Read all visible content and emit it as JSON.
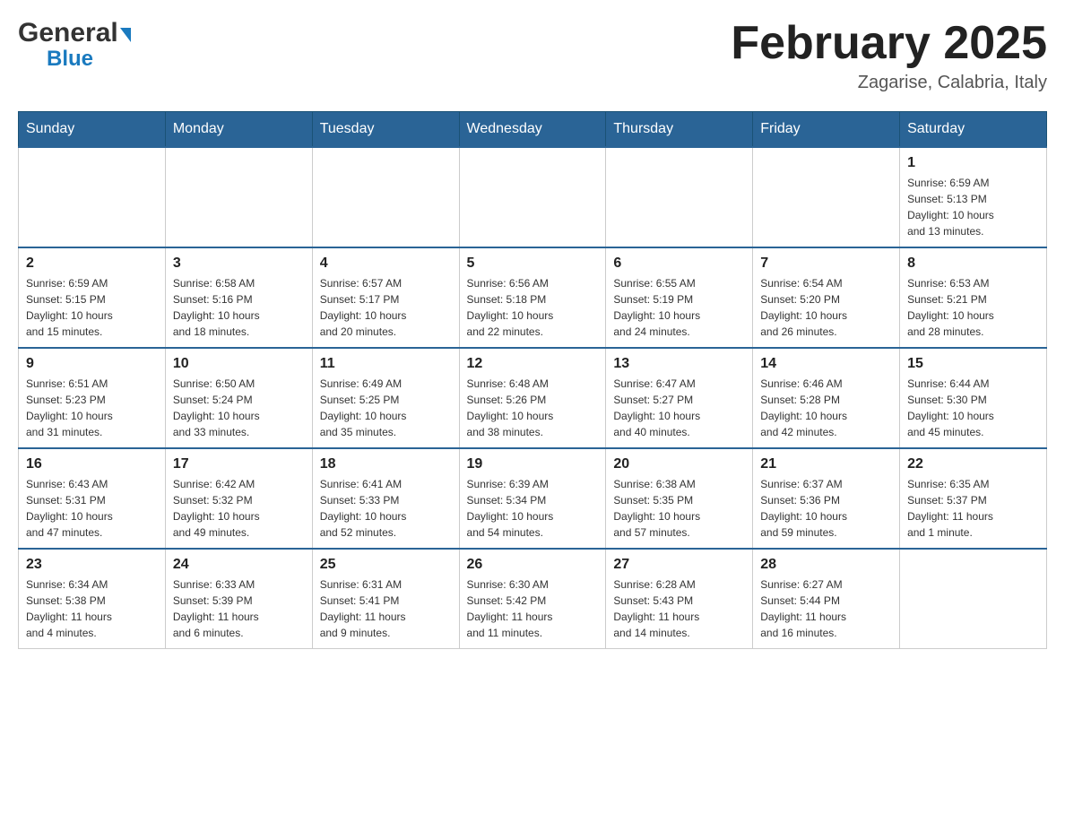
{
  "header": {
    "logo_general": "General",
    "logo_blue": "Blue",
    "month_title": "February 2025",
    "location": "Zagarise, Calabria, Italy"
  },
  "days_of_week": [
    "Sunday",
    "Monday",
    "Tuesday",
    "Wednesday",
    "Thursday",
    "Friday",
    "Saturday"
  ],
  "weeks": [
    [
      {
        "day": "",
        "info": ""
      },
      {
        "day": "",
        "info": ""
      },
      {
        "day": "",
        "info": ""
      },
      {
        "day": "",
        "info": ""
      },
      {
        "day": "",
        "info": ""
      },
      {
        "day": "",
        "info": ""
      },
      {
        "day": "1",
        "info": "Sunrise: 6:59 AM\nSunset: 5:13 PM\nDaylight: 10 hours\nand 13 minutes."
      }
    ],
    [
      {
        "day": "2",
        "info": "Sunrise: 6:59 AM\nSunset: 5:15 PM\nDaylight: 10 hours\nand 15 minutes."
      },
      {
        "day": "3",
        "info": "Sunrise: 6:58 AM\nSunset: 5:16 PM\nDaylight: 10 hours\nand 18 minutes."
      },
      {
        "day": "4",
        "info": "Sunrise: 6:57 AM\nSunset: 5:17 PM\nDaylight: 10 hours\nand 20 minutes."
      },
      {
        "day": "5",
        "info": "Sunrise: 6:56 AM\nSunset: 5:18 PM\nDaylight: 10 hours\nand 22 minutes."
      },
      {
        "day": "6",
        "info": "Sunrise: 6:55 AM\nSunset: 5:19 PM\nDaylight: 10 hours\nand 24 minutes."
      },
      {
        "day": "7",
        "info": "Sunrise: 6:54 AM\nSunset: 5:20 PM\nDaylight: 10 hours\nand 26 minutes."
      },
      {
        "day": "8",
        "info": "Sunrise: 6:53 AM\nSunset: 5:21 PM\nDaylight: 10 hours\nand 28 minutes."
      }
    ],
    [
      {
        "day": "9",
        "info": "Sunrise: 6:51 AM\nSunset: 5:23 PM\nDaylight: 10 hours\nand 31 minutes."
      },
      {
        "day": "10",
        "info": "Sunrise: 6:50 AM\nSunset: 5:24 PM\nDaylight: 10 hours\nand 33 minutes."
      },
      {
        "day": "11",
        "info": "Sunrise: 6:49 AM\nSunset: 5:25 PM\nDaylight: 10 hours\nand 35 minutes."
      },
      {
        "day": "12",
        "info": "Sunrise: 6:48 AM\nSunset: 5:26 PM\nDaylight: 10 hours\nand 38 minutes."
      },
      {
        "day": "13",
        "info": "Sunrise: 6:47 AM\nSunset: 5:27 PM\nDaylight: 10 hours\nand 40 minutes."
      },
      {
        "day": "14",
        "info": "Sunrise: 6:46 AM\nSunset: 5:28 PM\nDaylight: 10 hours\nand 42 minutes."
      },
      {
        "day": "15",
        "info": "Sunrise: 6:44 AM\nSunset: 5:30 PM\nDaylight: 10 hours\nand 45 minutes."
      }
    ],
    [
      {
        "day": "16",
        "info": "Sunrise: 6:43 AM\nSunset: 5:31 PM\nDaylight: 10 hours\nand 47 minutes."
      },
      {
        "day": "17",
        "info": "Sunrise: 6:42 AM\nSunset: 5:32 PM\nDaylight: 10 hours\nand 49 minutes."
      },
      {
        "day": "18",
        "info": "Sunrise: 6:41 AM\nSunset: 5:33 PM\nDaylight: 10 hours\nand 52 minutes."
      },
      {
        "day": "19",
        "info": "Sunrise: 6:39 AM\nSunset: 5:34 PM\nDaylight: 10 hours\nand 54 minutes."
      },
      {
        "day": "20",
        "info": "Sunrise: 6:38 AM\nSunset: 5:35 PM\nDaylight: 10 hours\nand 57 minutes."
      },
      {
        "day": "21",
        "info": "Sunrise: 6:37 AM\nSunset: 5:36 PM\nDaylight: 10 hours\nand 59 minutes."
      },
      {
        "day": "22",
        "info": "Sunrise: 6:35 AM\nSunset: 5:37 PM\nDaylight: 11 hours\nand 1 minute."
      }
    ],
    [
      {
        "day": "23",
        "info": "Sunrise: 6:34 AM\nSunset: 5:38 PM\nDaylight: 11 hours\nand 4 minutes."
      },
      {
        "day": "24",
        "info": "Sunrise: 6:33 AM\nSunset: 5:39 PM\nDaylight: 11 hours\nand 6 minutes."
      },
      {
        "day": "25",
        "info": "Sunrise: 6:31 AM\nSunset: 5:41 PM\nDaylight: 11 hours\nand 9 minutes."
      },
      {
        "day": "26",
        "info": "Sunrise: 6:30 AM\nSunset: 5:42 PM\nDaylight: 11 hours\nand 11 minutes."
      },
      {
        "day": "27",
        "info": "Sunrise: 6:28 AM\nSunset: 5:43 PM\nDaylight: 11 hours\nand 14 minutes."
      },
      {
        "day": "28",
        "info": "Sunrise: 6:27 AM\nSunset: 5:44 PM\nDaylight: 11 hours\nand 16 minutes."
      },
      {
        "day": "",
        "info": ""
      }
    ]
  ]
}
